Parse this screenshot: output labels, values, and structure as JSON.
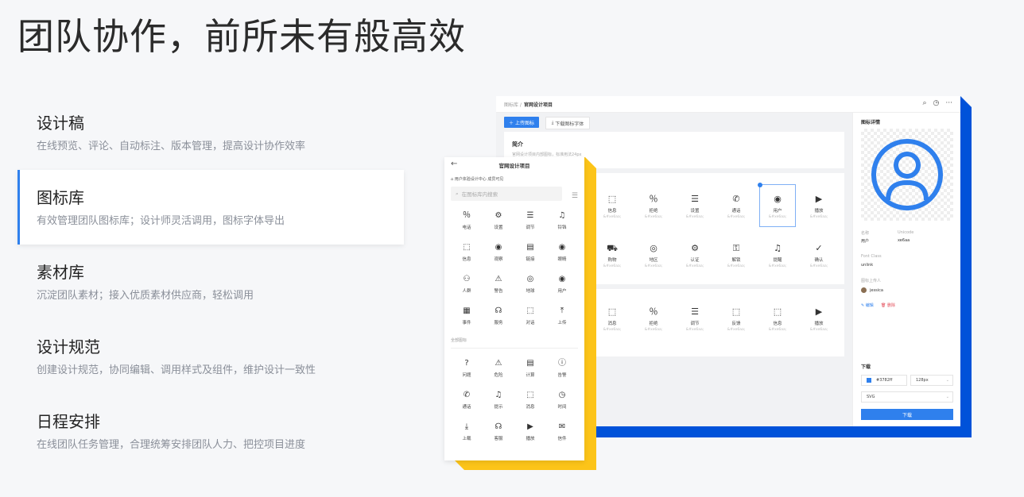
{
  "headline": "团队协作，前所未有般高效",
  "features": [
    {
      "title": "设计稿",
      "desc": "在线预览、评论、自动标注、版本管理，提高设计协作效率"
    },
    {
      "title": "图标库",
      "desc": "有效管理团队图标库；设计师灵活调用，图标字体导出"
    },
    {
      "title": "素材库",
      "desc": "沉淀团队素材；接入优质素材供应商，轻松调用"
    },
    {
      "title": "设计规范",
      "desc": "创建设计规范，协同编辑、调用样式及组件，维护设计一致性"
    },
    {
      "title": "日程安排",
      "desc": "在线团队任务管理，合理统筹安排团队人力、把控项目进度"
    }
  ],
  "desktop": {
    "breadcrumb_root": "图标库 /",
    "breadcrumb_current": "官网设计项目",
    "top_icons": [
      "search-icon",
      "clock-icon",
      "more-icon"
    ],
    "upload_label": "上传图标",
    "download_font_label": "下载图标字体",
    "intro_title": "简介",
    "intro_desc": "官网设计项目内部图标，标准用法24px",
    "grid1": [
      {
        "icon": "message-icon",
        "glyph": "⬚",
        "name": "信息",
        "code": "&#xe6aa;"
      },
      {
        "icon": "reject-icon",
        "glyph": "％",
        "name": "拒绝",
        "code": "&#xe6aa;"
      },
      {
        "icon": "sliders-icon",
        "glyph": "☰",
        "name": "设置",
        "code": "&#xe6aa;"
      },
      {
        "icon": "phone-icon",
        "glyph": "✆",
        "name": "通话",
        "code": "&#xe6aa;"
      },
      {
        "icon": "user-icon",
        "glyph": "◉",
        "name": "用户",
        "code": "&#xe6aa;",
        "selected": true
      },
      {
        "icon": "play-icon",
        "glyph": "▶",
        "name": "播放",
        "code": "&#xe6aa;"
      },
      {
        "icon": "cart-icon",
        "glyph": "⛟",
        "name": "购物",
        "code": "&#xe6aa;"
      },
      {
        "icon": "compass-icon",
        "glyph": "◎",
        "name": "地区",
        "code": "&#xe6aa;"
      },
      {
        "icon": "gear-icon",
        "glyph": "⚙",
        "name": "认证",
        "code": "&#xe6aa;"
      },
      {
        "icon": "lock-icon",
        "glyph": "⚿",
        "name": "解锁",
        "code": "&#xe6aa;"
      },
      {
        "icon": "bell-icon",
        "glyph": "♫",
        "name": "提醒",
        "code": "&#xe6aa;"
      },
      {
        "icon": "check-icon",
        "glyph": "✓",
        "name": "确认",
        "code": "&#xe6aa;"
      }
    ],
    "grid2": [
      {
        "icon": "message-icon",
        "glyph": "⬚",
        "name": "消息",
        "code": "&#xe6aa;"
      },
      {
        "icon": "reject-icon",
        "glyph": "％",
        "name": "拒绝",
        "code": "&#xe6aa;"
      },
      {
        "icon": "sliders-icon",
        "glyph": "☰",
        "name": "调节",
        "code": "&#xe6aa;"
      },
      {
        "icon": "feedback-icon",
        "glyph": "⬚",
        "name": "反馈",
        "code": "&#xe6aa;"
      },
      {
        "icon": "info-icon",
        "glyph": "⬚",
        "name": "信息",
        "code": "&#xe6aa;"
      },
      {
        "icon": "play-icon",
        "glyph": "▶",
        "name": "播放",
        "code": "&#xe6aa;"
      }
    ],
    "side": {
      "title": "图标详情",
      "name_label": "名称",
      "name_value": "用户",
      "unicode_label": "Unicode",
      "unicode_value": "xe6aa",
      "font_class_label": "Font Class",
      "font_class_value": "unlink",
      "uploader_label": "图标上传人",
      "uploader_value": "jessica",
      "edit_label": "编辑",
      "delete_label": "删除",
      "download_title": "下载",
      "color_value": "#3782ff",
      "size_value": "128px",
      "format_value": "SVG",
      "download_button": "下载",
      "accent_color": "#2f80ed"
    }
  },
  "mobile": {
    "title": "官网设计项目",
    "crumb": "用户体验设计中心  成员可见",
    "search_placeholder": "在图标库内搜索",
    "icons1": [
      {
        "icon": "reject-icon",
        "glyph": "％",
        "name": "电话"
      },
      {
        "icon": "gear-icon",
        "glyph": "⚙",
        "name": "设置"
      },
      {
        "icon": "sliders-icon",
        "glyph": "☰",
        "name": "调节"
      },
      {
        "icon": "bell-icon",
        "glyph": "♫",
        "name": "铃铛"
      },
      {
        "icon": "message-icon",
        "glyph": "⬚",
        "name": "信息"
      },
      {
        "icon": "eye-icon",
        "glyph": "◉",
        "name": "观察"
      },
      {
        "icon": "doc-icon",
        "glyph": "▤",
        "name": "链接"
      },
      {
        "icon": "eye-icon",
        "glyph": "◉",
        "name": "眼睛"
      },
      {
        "icon": "people-icon",
        "glyph": "⚇",
        "name": "人群"
      },
      {
        "icon": "warning-icon",
        "glyph": "⚠",
        "name": "警告"
      },
      {
        "icon": "globe-icon",
        "glyph": "◎",
        "name": "地球"
      },
      {
        "icon": "user-icon",
        "glyph": "◉",
        "name": "用户"
      },
      {
        "icon": "calendar-icon",
        "glyph": "▦",
        "name": "事件"
      },
      {
        "icon": "headset-icon",
        "glyph": "☊",
        "name": "服务"
      },
      {
        "icon": "message-icon",
        "glyph": "⬚",
        "name": "对话"
      },
      {
        "icon": "upload-icon",
        "glyph": "⤒",
        "name": "上传"
      }
    ],
    "section_label": "全部图标",
    "icons2": [
      {
        "icon": "help-icon",
        "glyph": "?",
        "name": "问题"
      },
      {
        "icon": "warning-icon",
        "glyph": "⚠",
        "name": "危险"
      },
      {
        "icon": "calculator-icon",
        "glyph": "▤",
        "name": "计算"
      },
      {
        "icon": "info-icon",
        "glyph": "ⓘ",
        "name": "告警"
      },
      {
        "icon": "phone-icon",
        "glyph": "✆",
        "name": "通话"
      },
      {
        "icon": "bell-icon",
        "glyph": "♫",
        "name": "提示"
      },
      {
        "icon": "message-icon",
        "glyph": "⬚",
        "name": "消息"
      },
      {
        "icon": "clock-icon",
        "glyph": "◷",
        "name": "时间"
      },
      {
        "icon": "download-icon",
        "glyph": "⤓",
        "name": "上载"
      },
      {
        "icon": "headset-icon",
        "glyph": "☊",
        "name": "客服"
      },
      {
        "icon": "play-icon",
        "glyph": "▶",
        "name": "播放"
      },
      {
        "icon": "mail-icon",
        "glyph": "✉",
        "name": "信件"
      }
    ]
  }
}
